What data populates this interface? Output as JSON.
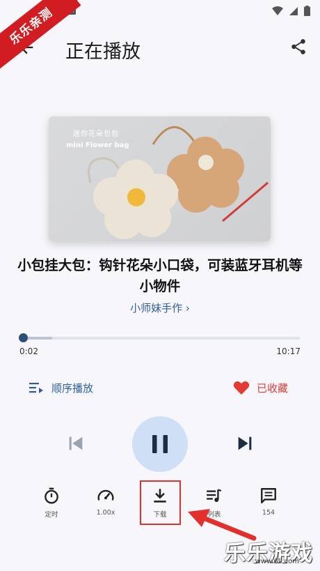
{
  "status_bar": {
    "notification_letter": "A",
    "icons": [
      "wifi-icon",
      "signal-icon",
      "battery-icon"
    ]
  },
  "watermark": {
    "corner_text": "乐乐亲测",
    "footer_text": "乐乐游戏",
    "footer_url": "www.6ll.com"
  },
  "header": {
    "title": "正在播放",
    "back_icon": "arrow-left-icon",
    "share_icon": "share-icon"
  },
  "cover": {
    "line1": "迷你花朵包包",
    "line2": "mini Flower bag"
  },
  "track": {
    "title": "小包挂大包：钩针花朵小口袋，可装蓝牙耳机等小物件",
    "author": "小师妹手作 ›"
  },
  "progress": {
    "current": "0:02",
    "total": "10:17",
    "fraction": 0.003
  },
  "controls": {
    "mode_label": "顺序播放",
    "favorite_label": "已收藏",
    "favorite_color": "#e23a35",
    "accent_color": "#2f5f9a"
  },
  "tools": [
    {
      "label": "定时",
      "icon": "timer-icon"
    },
    {
      "label": "1.00x",
      "icon": "speed-icon"
    },
    {
      "label": "下载",
      "icon": "download-icon"
    },
    {
      "label": "列表",
      "icon": "playlist-icon"
    },
    {
      "label": "154",
      "icon": "comment-icon"
    }
  ]
}
